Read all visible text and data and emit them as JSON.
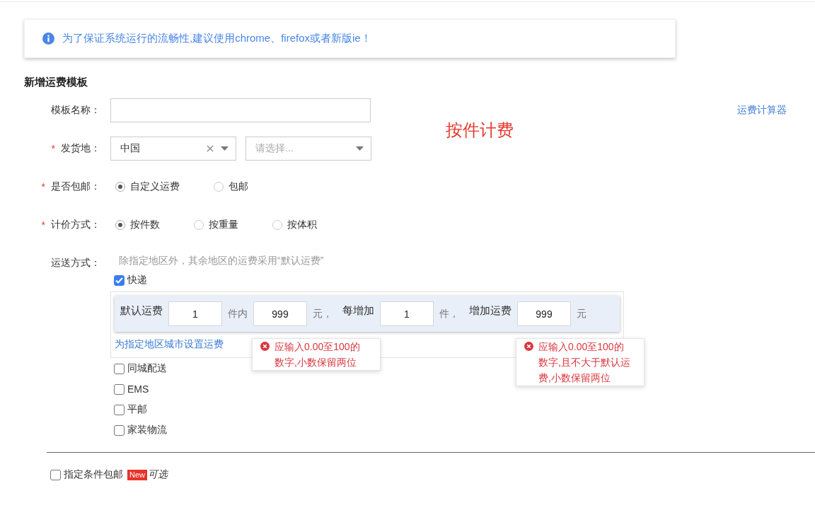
{
  "notice": {
    "text": "为了保证系统运行的流畅性,建议使用chrome、firefox或者新版ie！"
  },
  "title": "新增运费模板",
  "annotation": "按件计费",
  "fields": [
    {
      "kind": "text",
      "label": "模板名称：",
      "side_link": "运费计算器"
    },
    {
      "kind": "select",
      "required_mark": "*",
      "label": "发货地：",
      "selects": [
        {
          "value": "中国",
          "clearable": true
        },
        {
          "placeholder": "请选择...",
          "clearable": false
        }
      ]
    },
    {
      "kind": "radio",
      "required_mark": "*",
      "label": "是否包邮：",
      "options": [
        {
          "label": "自定义运费",
          "selected": true
        },
        {
          "label": "包邮",
          "selected": false
        }
      ]
    },
    {
      "kind": "radio",
      "required_mark": "*",
      "label": "计价方式：",
      "options": [
        {
          "label": "按件数",
          "selected": true
        },
        {
          "label": "按重量",
          "selected": false
        },
        {
          "label": "按体积",
          "selected": false
        }
      ]
    },
    {
      "kind": "shipping",
      "label": "运送方式：",
      "hint": "除指定地区外，其余地区的运费采用“默认运费”",
      "methods": [
        {
          "label": "快递",
          "checked": true,
          "rate_panel": {
            "items": [
              {
                "kind": "label",
                "text": "默认运费"
              },
              {
                "kind": "input",
                "value": "1"
              },
              {
                "kind": "unit",
                "text": "件内"
              },
              {
                "kind": "input",
                "value": "999",
                "error": "应输入0.00至100的数字,小数保留两位"
              },
              {
                "kind": "unit",
                "text": "元，"
              },
              {
                "kind": "label",
                "text": "每增加"
              },
              {
                "kind": "input",
                "value": "1"
              },
              {
                "kind": "unit",
                "text": "件，"
              },
              {
                "kind": "label",
                "text": "增加运费"
              },
              {
                "kind": "input",
                "value": "999",
                "error": "应输入0.00至100的数字,且不大于默认运费,小数保留两位"
              },
              {
                "kind": "unit",
                "text": "元"
              }
            ],
            "region_link": "为指定地区城市设置运费"
          }
        },
        {
          "label": "同城配送",
          "checked": false
        },
        {
          "label": "EMS",
          "checked": false
        },
        {
          "label": "平邮",
          "checked": false
        },
        {
          "label": "家装物流",
          "checked": false
        }
      ]
    }
  ],
  "free_shipping_condition": {
    "label": "指定条件包邮",
    "checked": false,
    "badge": "New",
    "note": "可选"
  }
}
